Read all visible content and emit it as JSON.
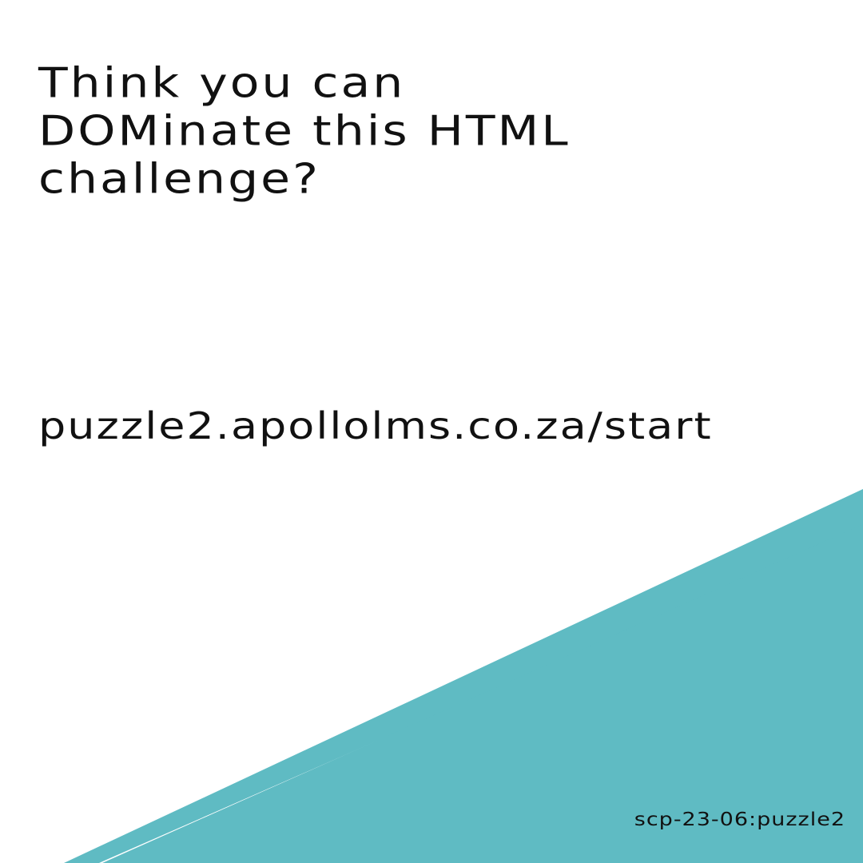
{
  "headline": {
    "line1": "Think you can",
    "line2": "DOMinate this HTML",
    "line3": "challenge?"
  },
  "link": {
    "url": "puzzle2.apollolms.co.za/start"
  },
  "footer": {
    "code": "scp-23-06:puzzle2"
  },
  "colors": {
    "background": "#ffffff",
    "text": "#111111",
    "teal": "#5fbbc3",
    "band_dark": "#1b1530"
  }
}
